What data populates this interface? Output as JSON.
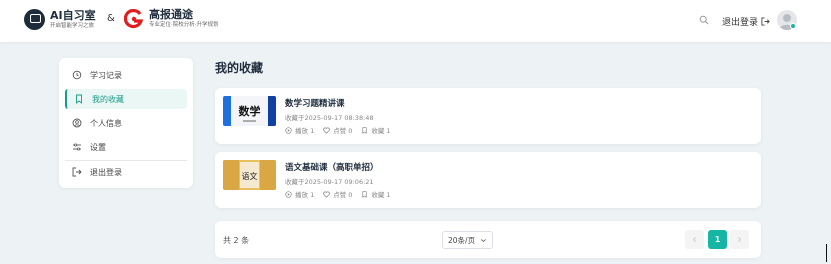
{
  "header": {
    "brand1_title": "AI自习室",
    "brand1_sub": "开启智能学习之旅",
    "amp": "&",
    "brand2_title": "高报通途",
    "brand2_sub": "专业定位·院校分析·升学规划",
    "logout_label": "退出登录"
  },
  "sidebar": {
    "items": [
      {
        "label": "学习记录",
        "icon": "history-icon"
      },
      {
        "label": "我的收藏",
        "icon": "bookmark-icon"
      },
      {
        "label": "个人信息",
        "icon": "user-icon"
      },
      {
        "label": "设置",
        "icon": "settings-icon"
      },
      {
        "label": "退出登录",
        "icon": "logout-icon"
      }
    ]
  },
  "main": {
    "title": "我的收藏",
    "courses": [
      {
        "title": "数学习题精讲课",
        "date": "收藏于2025-09-17 08:38:48",
        "plays": "播放 1",
        "likes": "点赞 0",
        "favs": "收藏 1",
        "thumb_text": "数学"
      },
      {
        "title": "语文基础课（高职单招）",
        "date": "收藏于2025-09-17 09:06:21",
        "plays": "播放 1",
        "likes": "点赞 0",
        "favs": "收藏 1",
        "thumb_text": "语文"
      }
    ]
  },
  "pagination": {
    "total": "共 2 条",
    "page_size": "20条/页",
    "current": "1"
  },
  "colors": {
    "accent": "#17b5a3",
    "background": "#edf2f4"
  }
}
